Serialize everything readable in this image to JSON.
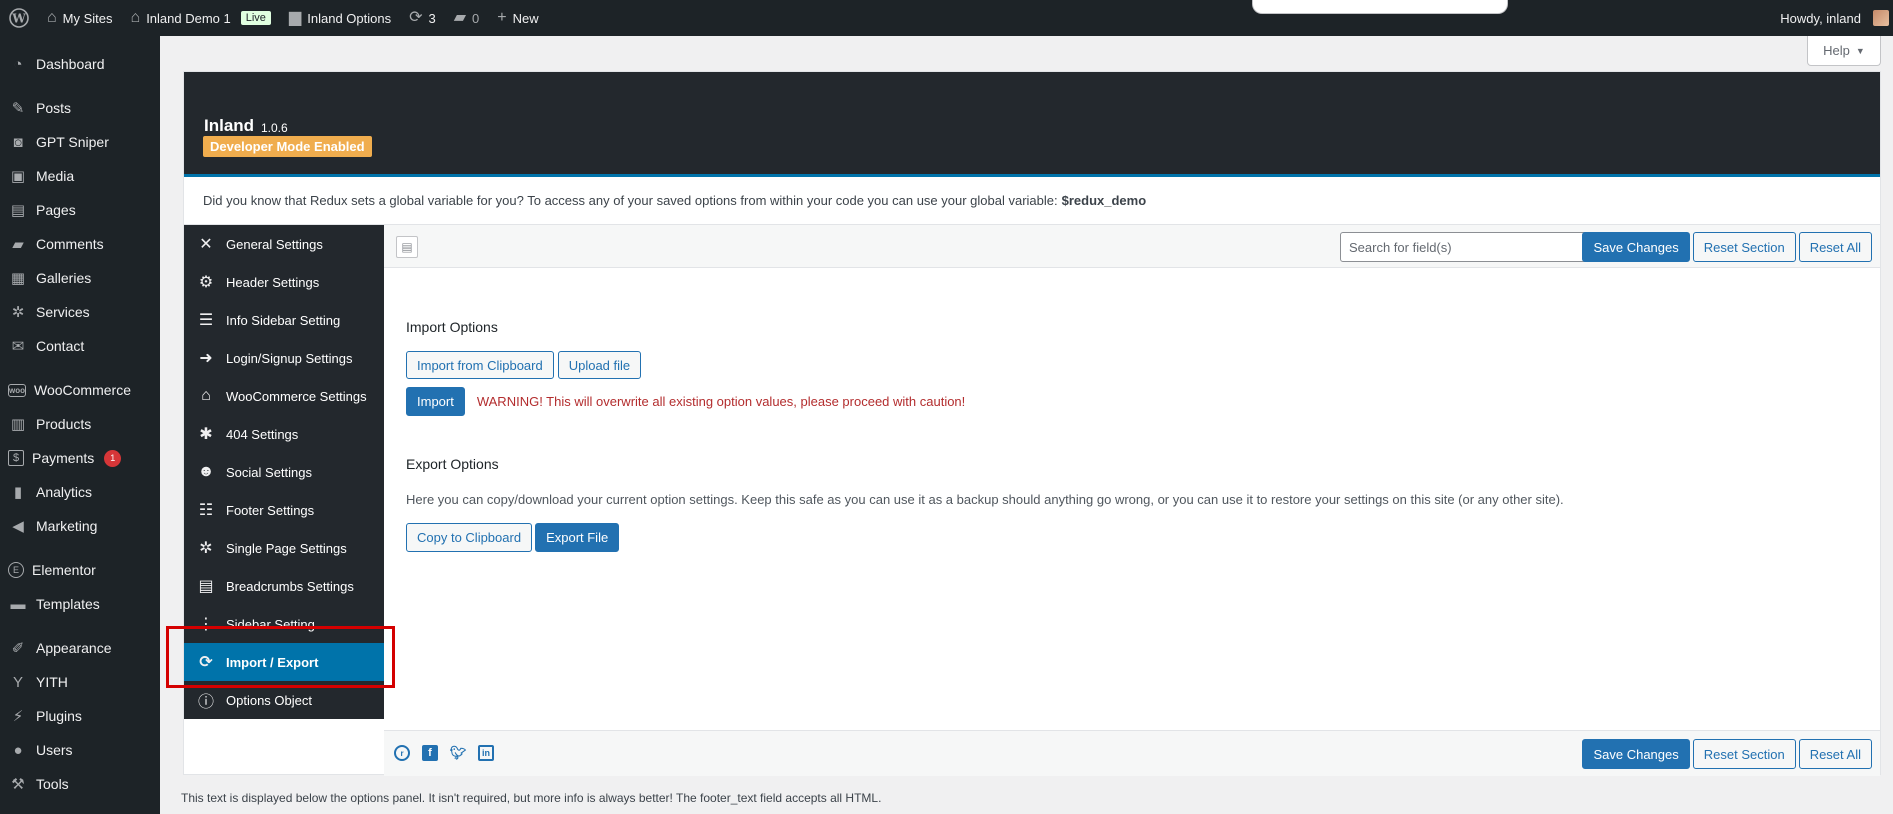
{
  "admin_bar": {
    "my_sites": "My Sites",
    "site_name": "Inland Demo 1",
    "live_badge": "Live",
    "options_link": "Inland Options",
    "updates_count": "3",
    "comments_count": "0",
    "new_label": "New",
    "greeting": "Howdy, inland"
  },
  "admin_menu": {
    "items": [
      {
        "label": "Dashboard",
        "icon": "dashboard-icon"
      },
      {
        "label": "Posts",
        "icon": "pin-icon"
      },
      {
        "label": "GPT Sniper",
        "icon": "robot-icon"
      },
      {
        "label": "Media",
        "icon": "media-icon"
      },
      {
        "label": "Pages",
        "icon": "pages-icon"
      },
      {
        "label": "Comments",
        "icon": "comment-icon"
      },
      {
        "label": "Galleries",
        "icon": "gallery-icon"
      },
      {
        "label": "Services",
        "icon": "gear-icon"
      },
      {
        "label": "Contact",
        "icon": "mail-icon"
      },
      {
        "label": "WooCommerce",
        "icon": "woo-icon"
      },
      {
        "label": "Products",
        "icon": "archive-icon"
      },
      {
        "label": "Payments",
        "icon": "dollar-icon",
        "badge": "1"
      },
      {
        "label": "Analytics",
        "icon": "bar-chart-icon"
      },
      {
        "label": "Marketing",
        "icon": "megaphone-icon"
      },
      {
        "label": "Elementor",
        "icon": "elementor-icon"
      },
      {
        "label": "Templates",
        "icon": "folder-icon"
      },
      {
        "label": "Appearance",
        "icon": "brush-icon"
      },
      {
        "label": "YITH",
        "icon": "yith-icon"
      },
      {
        "label": "Plugins",
        "icon": "plug-icon"
      },
      {
        "label": "Users",
        "icon": "user-icon"
      },
      {
        "label": "Tools",
        "icon": "wrench-icon"
      }
    ]
  },
  "help_tab": {
    "label": "Help"
  },
  "redux_header": {
    "title": "Inland",
    "version": "1.0.6",
    "dev_mode": "Developer Mode Enabled"
  },
  "notice": {
    "text": "Did you know that Redux sets a global variable for you? To access any of your saved options from within your code you can use your global variable:",
    "variable": "$redux_demo"
  },
  "redux_nav": {
    "items": [
      {
        "label": "General Settings",
        "icon": "tools-icon"
      },
      {
        "label": "Header Settings",
        "icon": "cogs-icon"
      },
      {
        "label": "Info Sidebar Setting",
        "icon": "list-icon"
      },
      {
        "label": "Login/Signup Settings",
        "icon": "sign-in-icon"
      },
      {
        "label": "WooCommerce Settings",
        "icon": "store-icon"
      },
      {
        "label": "404 Settings",
        "icon": "bug-icon"
      },
      {
        "label": "Social Settings",
        "icon": "users-icon"
      },
      {
        "label": "Footer Settings",
        "icon": "sliders-icon"
      },
      {
        "label": "Single Page Settings",
        "icon": "cog-icon"
      },
      {
        "label": "Breadcrumbs Settings",
        "icon": "server-icon"
      },
      {
        "label": "Sidebar Setting",
        "icon": "ellipsis-icon"
      },
      {
        "label": "Import / Export",
        "icon": "refresh-icon",
        "active": true
      },
      {
        "label": "Options Object",
        "icon": "info-icon"
      }
    ]
  },
  "toolbar": {
    "search_placeholder": "Search for field(s)",
    "save_label": "Save Changes",
    "reset_section_label": "Reset Section",
    "reset_all_label": "Reset All"
  },
  "import": {
    "title": "Import Options",
    "from_clipboard": "Import from Clipboard",
    "upload_file": "Upload file",
    "import_button": "Import",
    "warning": "WARNING! This will overwrite all existing option values, please proceed with caution!"
  },
  "export": {
    "title": "Export Options",
    "description": "Here you can copy/download your current option settings. Keep this safe as you can use it as a backup should anything go wrong, or you can use it to restore your settings on this site (or any other site).",
    "copy_button": "Copy to Clipboard",
    "export_button": "Export File"
  },
  "footer": {
    "text": "This text is displayed below the options panel. It isn't required, but more info is always better! The footer_text field accepts all HTML."
  }
}
